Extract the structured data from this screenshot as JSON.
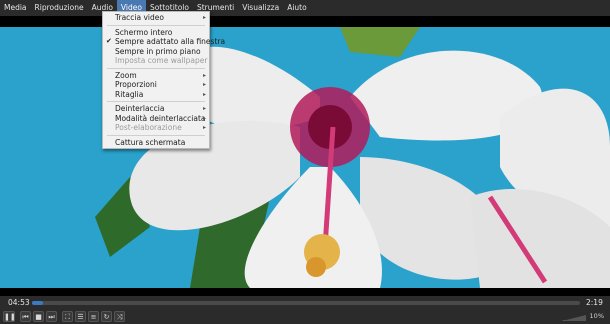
{
  "menubar": {
    "items": [
      "Media",
      "Riproduzione",
      "Audio",
      "Video",
      "Sottotitolo",
      "Strumenti",
      "Visualizza",
      "Aiuto"
    ]
  },
  "video_menu": {
    "items": [
      {
        "label": "Traccia video",
        "submenu": true
      },
      {
        "label": "Schermo intero"
      },
      {
        "label": "Sempre adattato alla finestra",
        "checked": true
      },
      {
        "label": "Sempre in primo piano"
      },
      {
        "label": "Imposta come wallpaper",
        "disabled": true
      },
      {
        "label": "Zoom",
        "submenu": true
      },
      {
        "label": "Proporzioni",
        "submenu": true
      },
      {
        "label": "Ritaglia",
        "submenu": true
      },
      {
        "label": "Deinterlaccia",
        "submenu": true
      },
      {
        "label": "Modalità deinterlacciata",
        "submenu": true
      },
      {
        "label": "Post-elaborazione",
        "submenu": true,
        "disabled": true
      },
      {
        "label": "Cattura schermata"
      }
    ],
    "check_glyph": "✔",
    "arrow_glyph": "▸"
  },
  "player": {
    "time_elapsed": "04:53",
    "time_total": "2:19",
    "progress": 0.01,
    "volume_label": "10%",
    "accent_color": "#3b79c4"
  },
  "controls": {
    "buttons": [
      {
        "name": "pause-icon",
        "glyph": "❚❚"
      },
      {
        "name": "previous-icon",
        "glyph": "⏮"
      },
      {
        "name": "stop-icon",
        "glyph": "■"
      },
      {
        "name": "next-icon",
        "glyph": "⏭"
      },
      {
        "name": "fullscreen-icon",
        "glyph": "⛶"
      },
      {
        "name": "extended-settings-icon",
        "glyph": "☰"
      },
      {
        "name": "playlist-icon",
        "glyph": "≡"
      },
      {
        "name": "loop-icon",
        "glyph": "↻"
      },
      {
        "name": "shuffle-icon",
        "glyph": "⤨"
      }
    ]
  }
}
